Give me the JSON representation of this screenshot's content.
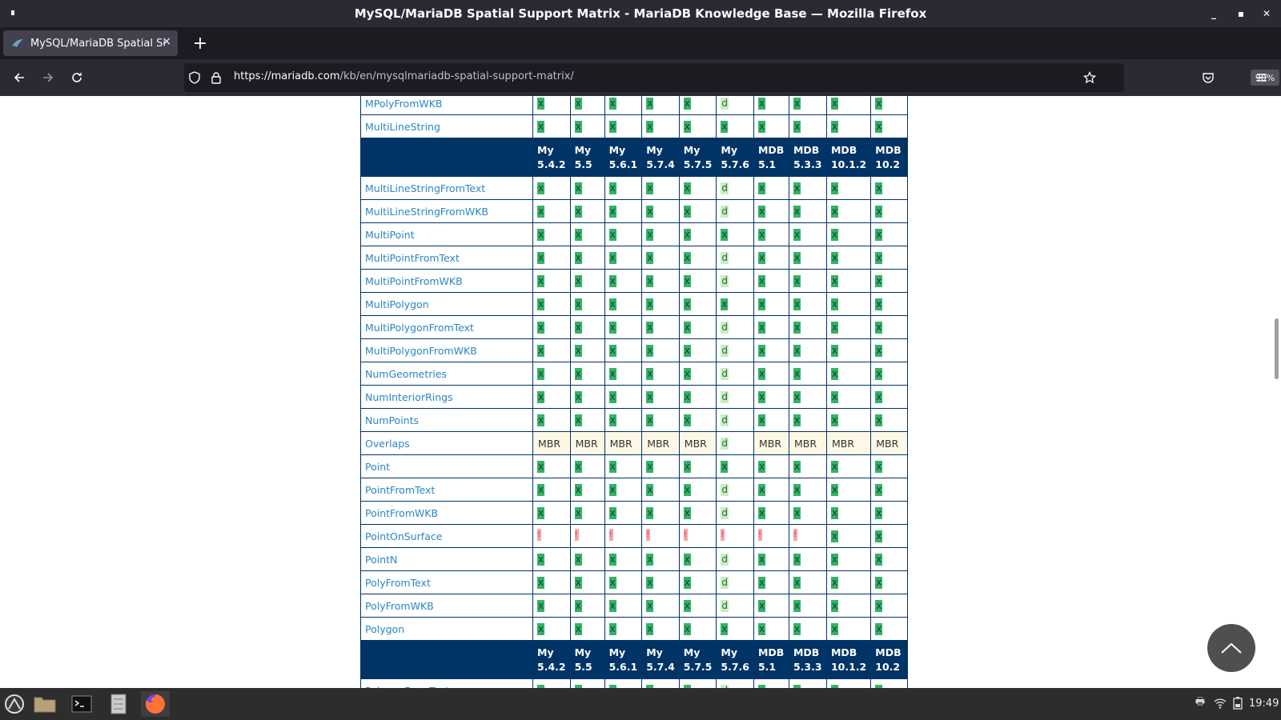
{
  "window": {
    "title": "MySQL/MariaDB Spatial Support Matrix - MariaDB Knowledge Base — Mozilla Firefox"
  },
  "tab": {
    "title": "MySQL/MariaDB Spatial Sup",
    "close": "×"
  },
  "newtab": "+",
  "nav": {
    "url_host": "https://mariadb.com",
    "url_path": "/kb/en/mysqlmariadb-spatial-support-matrix/",
    "zoom": "90%"
  },
  "table": {
    "header_versions": [
      [
        "My",
        "5.4.2"
      ],
      [
        "My",
        "5.5"
      ],
      [
        "My",
        "5.6.1"
      ],
      [
        "My",
        "5.7.4"
      ],
      [
        "My",
        "5.7.5"
      ],
      [
        "My",
        "5.7.6"
      ],
      [
        "MDB",
        "5.1"
      ],
      [
        "MDB",
        "5.3.3"
      ],
      [
        "MDB",
        "10.1.2"
      ],
      [
        "MDB",
        "10.2"
      ]
    ],
    "rows_before": [
      {
        "name": "MPolyFromWKB",
        "cells": [
          "x",
          "x",
          "x",
          "x",
          "x",
          "d",
          "x",
          "x",
          "x",
          "x"
        ]
      },
      {
        "name": "MultiLineString",
        "cells": [
          "x",
          "x",
          "x",
          "x",
          "x",
          "x",
          "x",
          "x",
          "x",
          "x"
        ]
      }
    ],
    "rows_middle": [
      {
        "name": "MultiLineStringFromText",
        "cells": [
          "x",
          "x",
          "x",
          "x",
          "x",
          "d",
          "x",
          "x",
          "x",
          "x"
        ]
      },
      {
        "name": "MultiLineStringFromWKB",
        "cells": [
          "x",
          "x",
          "x",
          "x",
          "x",
          "d",
          "x",
          "x",
          "x",
          "x"
        ]
      },
      {
        "name": "MultiPoint",
        "cells": [
          "x",
          "x",
          "x",
          "x",
          "x",
          "x",
          "x",
          "x",
          "x",
          "x"
        ]
      },
      {
        "name": "MultiPointFromText",
        "cells": [
          "x",
          "x",
          "x",
          "x",
          "x",
          "d",
          "x",
          "x",
          "x",
          "x"
        ]
      },
      {
        "name": "MultiPointFromWKB",
        "cells": [
          "x",
          "x",
          "x",
          "x",
          "x",
          "d",
          "x",
          "x",
          "x",
          "x"
        ]
      },
      {
        "name": "MultiPolygon",
        "cells": [
          "x",
          "x",
          "x",
          "x",
          "x",
          "x",
          "x",
          "x",
          "x",
          "x"
        ]
      },
      {
        "name": "MultiPolygonFromText",
        "cells": [
          "x",
          "x",
          "x",
          "x",
          "x",
          "d",
          "x",
          "x",
          "x",
          "x"
        ]
      },
      {
        "name": "MultiPolygonFromWKB",
        "cells": [
          "x",
          "x",
          "x",
          "x",
          "x",
          "d",
          "x",
          "x",
          "x",
          "x"
        ]
      },
      {
        "name": "NumGeometries",
        "cells": [
          "x",
          "x",
          "x",
          "x",
          "x",
          "d",
          "x",
          "x",
          "x",
          "x"
        ]
      },
      {
        "name": "NumInteriorRings",
        "cells": [
          "x",
          "x",
          "x",
          "x",
          "x",
          "d",
          "x",
          "x",
          "x",
          "x"
        ]
      },
      {
        "name": "NumPoints",
        "cells": [
          "x",
          "x",
          "x",
          "x",
          "x",
          "d",
          "x",
          "x",
          "x",
          "x"
        ]
      },
      {
        "name": "Overlaps",
        "cells": [
          "MBR",
          "MBR",
          "MBR",
          "MBR",
          "MBR",
          "d",
          "MBR",
          "MBR",
          "MBR",
          "MBR"
        ]
      },
      {
        "name": "Point",
        "cells": [
          "x",
          "x",
          "x",
          "x",
          "x",
          "x",
          "x",
          "x",
          "x",
          "x"
        ]
      },
      {
        "name": "PointFromText",
        "cells": [
          "x",
          "x",
          "x",
          "x",
          "x",
          "d",
          "x",
          "x",
          "x",
          "x"
        ]
      },
      {
        "name": "PointFromWKB",
        "cells": [
          "x",
          "x",
          "x",
          "x",
          "x",
          "d",
          "x",
          "x",
          "x",
          "x"
        ]
      },
      {
        "name": "PointOnSurface",
        "cells": [
          "!",
          "!",
          "!",
          "!",
          "!",
          "!",
          "!",
          "!",
          "x",
          "x"
        ]
      },
      {
        "name": "PointN",
        "cells": [
          "x",
          "x",
          "x",
          "x",
          "x",
          "d",
          "x",
          "x",
          "x",
          "x"
        ]
      },
      {
        "name": "PolyFromText",
        "cells": [
          "x",
          "x",
          "x",
          "x",
          "x",
          "d",
          "x",
          "x",
          "x",
          "x"
        ]
      },
      {
        "name": "PolyFromWKB",
        "cells": [
          "x",
          "x",
          "x",
          "x",
          "x",
          "d",
          "x",
          "x",
          "x",
          "x"
        ]
      },
      {
        "name": "Polygon",
        "cells": [
          "x",
          "x",
          "x",
          "x",
          "x",
          "x",
          "x",
          "x",
          "x",
          "x"
        ]
      }
    ],
    "rows_after": [
      {
        "name": "PolygonFromText",
        "cells": [
          "x",
          "x",
          "x",
          "x",
          "x",
          "d",
          "x",
          "x",
          "x",
          "x"
        ]
      }
    ]
  },
  "taskbar": {
    "clock": "19:49"
  },
  "icons": {
    "back": "arrow-left-icon",
    "forward": "arrow-right-icon",
    "reload": "reload-icon",
    "shield": "shield-icon",
    "lock": "lock-icon",
    "star": "star-icon",
    "pocket": "pocket-icon",
    "menu": "hamburger-menu-icon",
    "totop": "chevron-up-icon"
  },
  "colors": {
    "header_bg": "#003366",
    "link": "#2a86c5",
    "yes": "#33b36a",
    "dev": "#c6eec6",
    "no": "#f4a6a6",
    "mbr": "#fdf8e6"
  }
}
